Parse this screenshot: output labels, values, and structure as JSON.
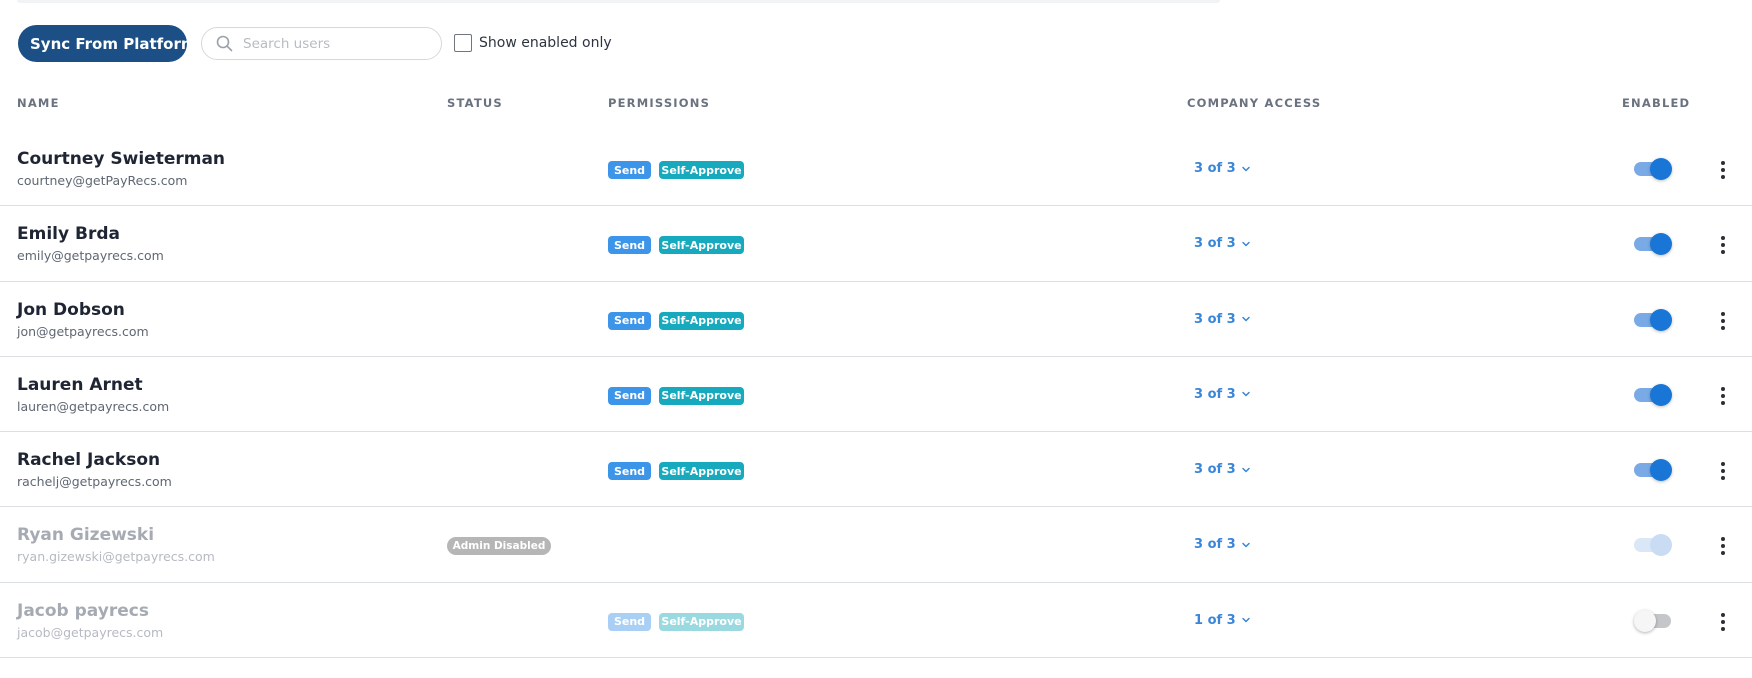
{
  "toolbar": {
    "sync_label": "Sync From Platform",
    "search_placeholder": "Search users",
    "search_value": "",
    "filter_label": "Show enabled only",
    "filter_checked": false
  },
  "columns": {
    "name": "NAME",
    "status": "STATUS",
    "permissions": "PERMISSIONS",
    "company_access": "COMPANY ACCESS",
    "enabled": "ENABLED"
  },
  "rows": [
    {
      "name": "Courtney Swieterman",
      "email": "courtney@getPayRecs.com",
      "status": "",
      "permissions": [
        "Send",
        "Self-Approve"
      ],
      "access": "3 of 3",
      "enabled": true,
      "user_disabled": false
    },
    {
      "name": "Emily Brda",
      "email": "emily@getpayrecs.com",
      "status": "",
      "permissions": [
        "Send",
        "Self-Approve"
      ],
      "access": "3 of 3",
      "enabled": true,
      "user_disabled": false
    },
    {
      "name": "Jon Dobson",
      "email": "jon@getpayrecs.com",
      "status": "",
      "permissions": [
        "Send",
        "Self-Approve"
      ],
      "access": "3 of 3",
      "enabled": true,
      "user_disabled": false
    },
    {
      "name": "Lauren Arnet",
      "email": "lauren@getpayrecs.com",
      "status": "",
      "permissions": [
        "Send",
        "Self-Approve"
      ],
      "access": "3 of 3",
      "enabled": true,
      "user_disabled": false
    },
    {
      "name": "Rachel Jackson",
      "email": "rachelj@getpayrecs.com",
      "status": "",
      "permissions": [
        "Send",
        "Self-Approve"
      ],
      "access": "3 of 3",
      "enabled": true,
      "user_disabled": false
    },
    {
      "name": "Ryan Gizewski",
      "email": "ryan.gizewski@getpayrecs.com",
      "status": "Admin Disabled",
      "permissions": [],
      "access": "3 of 3",
      "enabled": true,
      "user_disabled": true
    },
    {
      "name": "Jacob payrecs",
      "email": "jacob@getpayrecs.com",
      "status": "",
      "permissions": [
        "Send",
        "Self-Approve"
      ],
      "access": "1 of 3",
      "enabled": false,
      "user_disabled": true
    }
  ],
  "colors": {
    "primary": "#1b4f86",
    "send_badge": "#3d95ea",
    "self_approve_badge": "#17a9bd",
    "link": "#3a86d8",
    "toggle_on": "#1a76d6"
  }
}
